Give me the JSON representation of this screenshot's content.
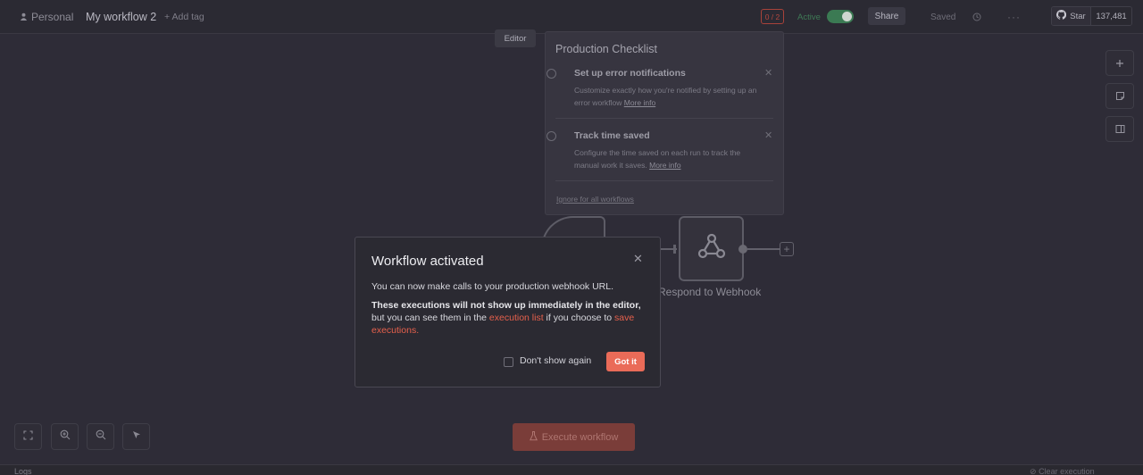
{
  "topbar": {
    "project": "Personal",
    "workflow_title": "My workflow 2",
    "add_tag": "+ Add tag",
    "badge": "0 / 2",
    "active_label": "Active",
    "active": true,
    "share_label": "Share",
    "saved_label": "Saved",
    "history_icon": "history-icon",
    "more_icon": "more-icon",
    "github": {
      "star_label": "Star",
      "count": "137,481"
    }
  },
  "tabs": {
    "editor": "Editor"
  },
  "checklist": {
    "title": "Production Checklist",
    "items": [
      {
        "title": "Set up error notifications",
        "desc": "Customize exactly how you're notified by setting up an error workflow",
        "link": "More info"
      },
      {
        "title": "Track time saved",
        "desc": "Configure the time saved on each run to track the manual work it saves.",
        "link": "More info"
      }
    ],
    "ignore_label": "Ignore for all workflows"
  },
  "canvas": {
    "node_label": "Respond to Webhook",
    "execute_label": "Execute workflow"
  },
  "bottombar": {
    "logs_label": "Logs",
    "clear_label": "Clear execution"
  },
  "dialog": {
    "title": "Workflow activated",
    "line1": "You can now make calls to your production webhook URL.",
    "line2_bold": "These executions will not show up immediately in the editor,",
    "line2_rest_a": "but you can see them in the",
    "link1": "execution list",
    "line2_rest_b": "if you choose to",
    "link2": "save executions.",
    "checkbox_label": "Don't show again",
    "checkbox_checked": false,
    "button_label": "Got it"
  },
  "colors": {
    "accent": "#ea6b58",
    "active_green": "#3b7a53",
    "background": "#2e2c37"
  }
}
